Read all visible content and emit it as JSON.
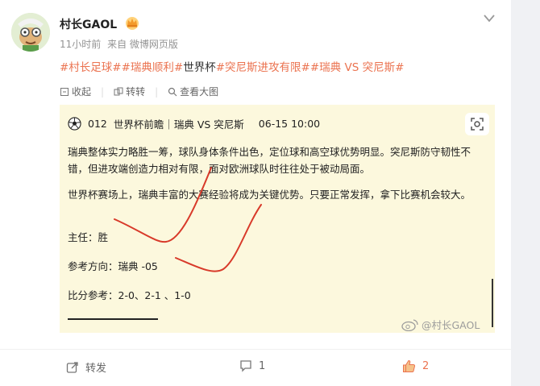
{
  "post": {
    "author": "村长GAOL",
    "time": "11小时前",
    "source": "来自 微博网页版",
    "topics": [
      {
        "text": "#村长足球#",
        "link": true
      },
      {
        "text": "#瑞典顺利#",
        "link": true
      },
      {
        "text": "世界杯",
        "link": false
      },
      {
        "text": "#突尼斯进攻有限#",
        "link": true
      },
      {
        "text": "#瑞典 VS 突尼斯#",
        "link": true
      }
    ]
  },
  "toolbar": {
    "collect": "收起",
    "repost": "转转",
    "view_large": "查看大图"
  },
  "image": {
    "title_code": "012",
    "title_text": "世界杯前瞻｜瑞典 VS 突尼斯",
    "title_time": "06-15 10:00",
    "para1": "瑞典整体实力略胜一筹，球队身体条件出色，定位球和高空球优势明显。突尼斯防守韧性不错，但进攻端创造力相对有限，面对欧洲球队时往往处于被动局面。",
    "para2": "世界杯赛场上，瑞典丰富的大赛经验将成为关键优势。只要正常发挥，拿下比赛机会较大。",
    "main": "主任：胜",
    "direction": "参考方向：瑞典 -05",
    "score": "比分参考：2-0、2-1 、1-0",
    "watermark": "@村长GAOL"
  },
  "footer": {
    "share": "转发",
    "comments": "1",
    "likes": "2"
  },
  "colors": {
    "accent": "#eb7350",
    "image_bg": "#fcf8dd",
    "annotation_stroke": "#d83a2a"
  }
}
